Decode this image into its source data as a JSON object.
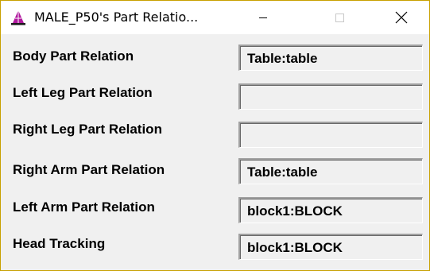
{
  "window": {
    "title": "MALE_P50's Part Relatio...",
    "app_icon": "pyramid-figure-icon",
    "controls": {
      "minimize_icon": "minimize-icon",
      "maximize_icon": "maximize-icon",
      "close_icon": "close-icon"
    }
  },
  "relations": [
    {
      "label": "Body Part Relation",
      "value": "Table:table"
    },
    {
      "label": "Left Leg Part Relation",
      "value": ""
    },
    {
      "label": "Right Leg Part Relation",
      "value": ""
    },
    {
      "label": "Right Arm Part Relation",
      "value": "Table:table"
    },
    {
      "label": "Left Arm Part Relation",
      "value": "block1:BLOCK"
    },
    {
      "label": "Head Tracking",
      "value": "block1:BLOCK"
    }
  ],
  "colors": {
    "window_border": "#c8a000",
    "icon_magenta": "#b0189e",
    "client_background": "#f0f0f0"
  }
}
